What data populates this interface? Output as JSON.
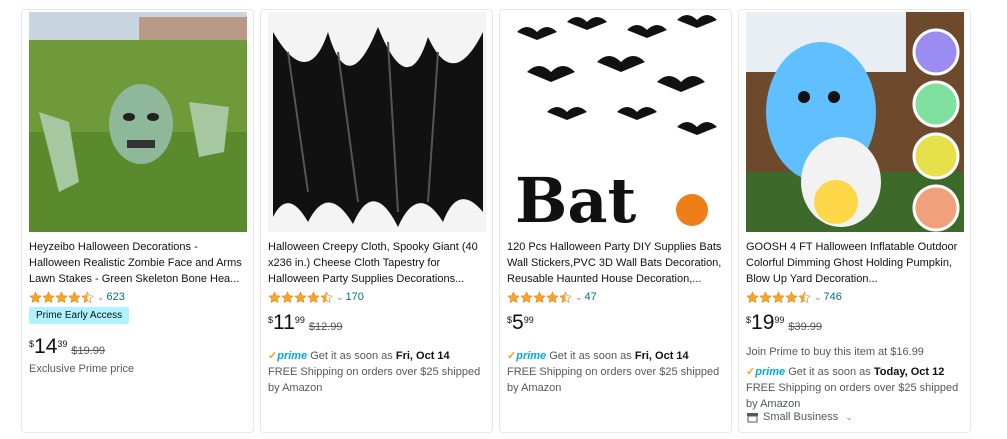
{
  "products": [
    {
      "title": "Heyzeibo Halloween Decorations - Halloween Realistic Zombie Face and Arms Lawn Stakes - Green Skeleton Bone Hea...",
      "rating_count": "623",
      "badge": "Prime Early Access",
      "price_symbol": "$",
      "price_whole": "14",
      "price_fraction": "39",
      "was_price": "$19.99",
      "note": "Exclusive Prime price"
    },
    {
      "title": "Halloween Creepy Cloth, Spooky Giant (40 x236 in.) Cheese Cloth Tapestry for Halloween Party Supplies Decorations...",
      "rating_count": "170",
      "price_symbol": "$",
      "price_whole": "11",
      "price_fraction": "99",
      "was_price": "$12.99",
      "prime_label": "prime",
      "delivery_text": "Get it as soon as",
      "delivery_date": "Fri, Oct 14",
      "shipping_text": "FREE Shipping on orders over $25 shipped by Amazon"
    },
    {
      "title": "120 Pcs Halloween Party DIY Supplies Bats Wall Stickers,PVC 3D Wall Bats Decoration, Reusable Haunted House Decoration,...",
      "rating_count": "47",
      "price_symbol": "$",
      "price_whole": "5",
      "price_fraction": "99",
      "prime_label": "prime",
      "delivery_text": "Get it as soon as",
      "delivery_date": "Fri, Oct 14",
      "shipping_text": "FREE Shipping on orders over $25 shipped by Amazon"
    },
    {
      "title": "GOOSH 4 FT Halloween Inflatable Outdoor Colorful Dimming Ghost Holding Pumpkin, Blow Up Yard Decoration...",
      "rating_count": "746",
      "price_symbol": "$",
      "price_whole": "19",
      "price_fraction": "99",
      "was_price": "$39.99",
      "join_prime": "Join Prime to buy this item at $16.99",
      "prime_label": "prime",
      "delivery_text": "Get it as soon as",
      "delivery_date": "Today, Oct 12",
      "shipping_text": "FREE Shipping on orders over $25 shipped by Amazon",
      "small_business": "Small Business"
    }
  ],
  "colors": {
    "star": "#ffa41c",
    "link": "#007185",
    "badge_bg": "#aef3ff",
    "prime_blue": "#00a8e1"
  }
}
